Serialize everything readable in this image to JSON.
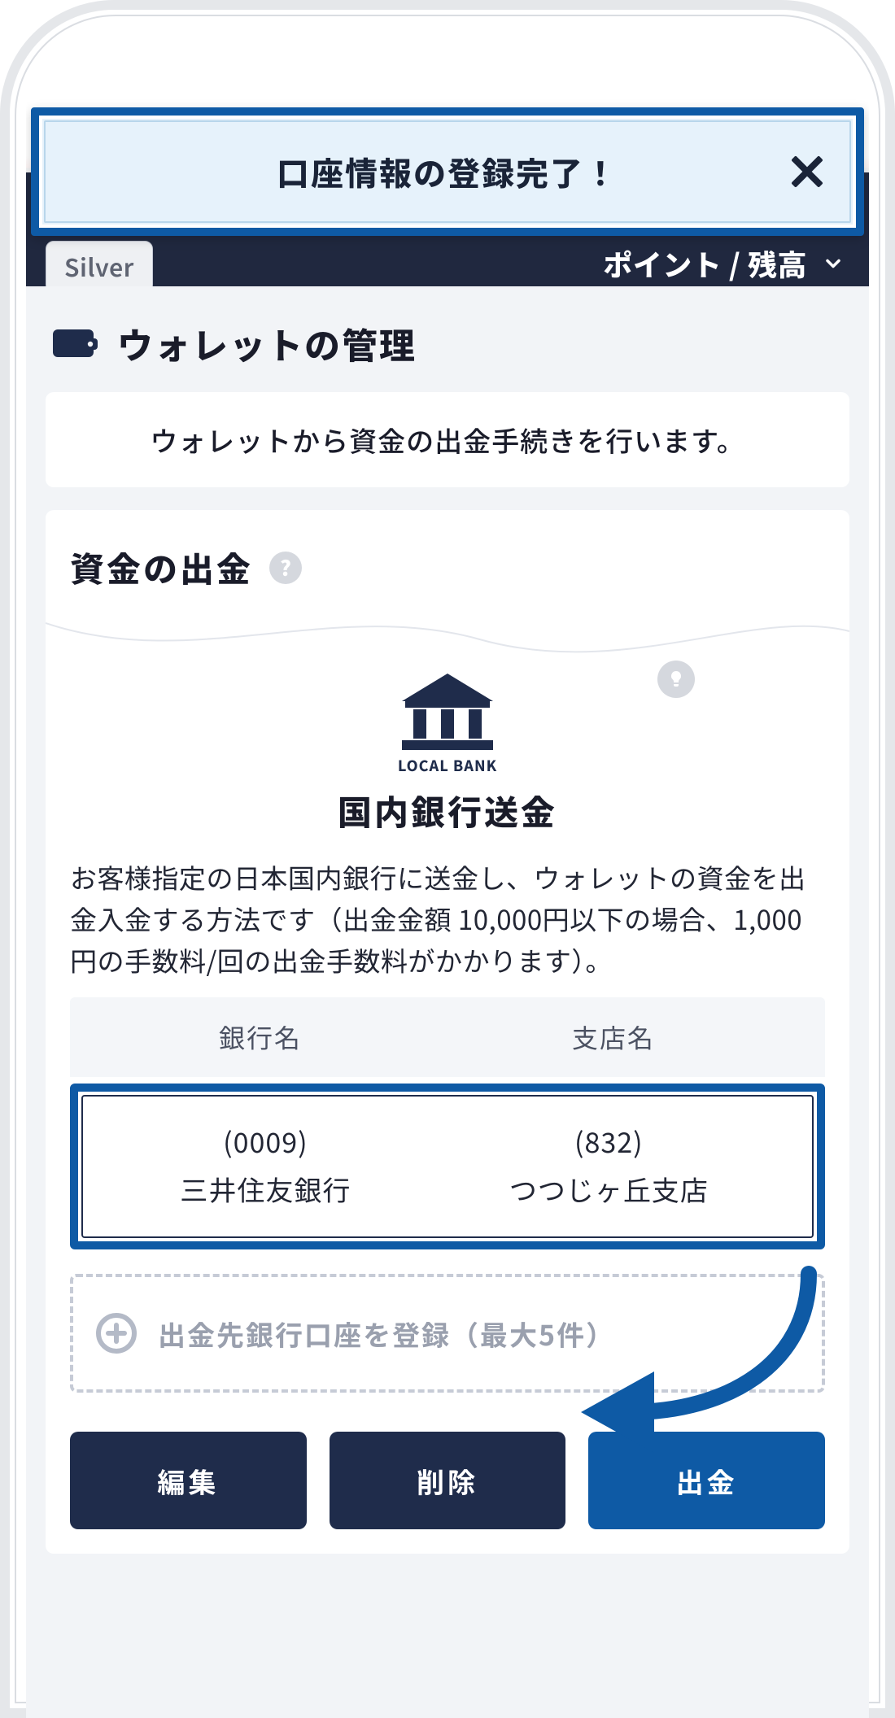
{
  "toast": {
    "message": "口座情報の登録完了！",
    "close_label": "閉じる"
  },
  "header": {
    "tier_label": "Silver",
    "points_label": "ポイント / 残高"
  },
  "page": {
    "title": "ウォレットの管理",
    "intro": "ウォレットから資金の出金手続きを行います。"
  },
  "withdraw": {
    "section_title": "資金の出金",
    "bank_logo_text": "LOCAL BANK",
    "bank_title": "国内銀行送金",
    "description": "お客様指定の日本国内銀行に送金し、ウォレットの資金を出金入金する方法です（出金金額 10,000円以下の場合、1,000円の手数料/回の出金手数料がかかります）。",
    "columns": {
      "bank": "銀行名",
      "branch": "支店名"
    },
    "row": {
      "bank_code": "(0009)",
      "bank_name": "三井住友銀行",
      "branch_code": "(832)",
      "branch_name": "つつじヶ丘支店"
    },
    "add_label": "出金先銀行口座を登録（最大5件）",
    "buttons": {
      "edit": "編集",
      "delete": "削除",
      "withdraw": "出金"
    }
  }
}
